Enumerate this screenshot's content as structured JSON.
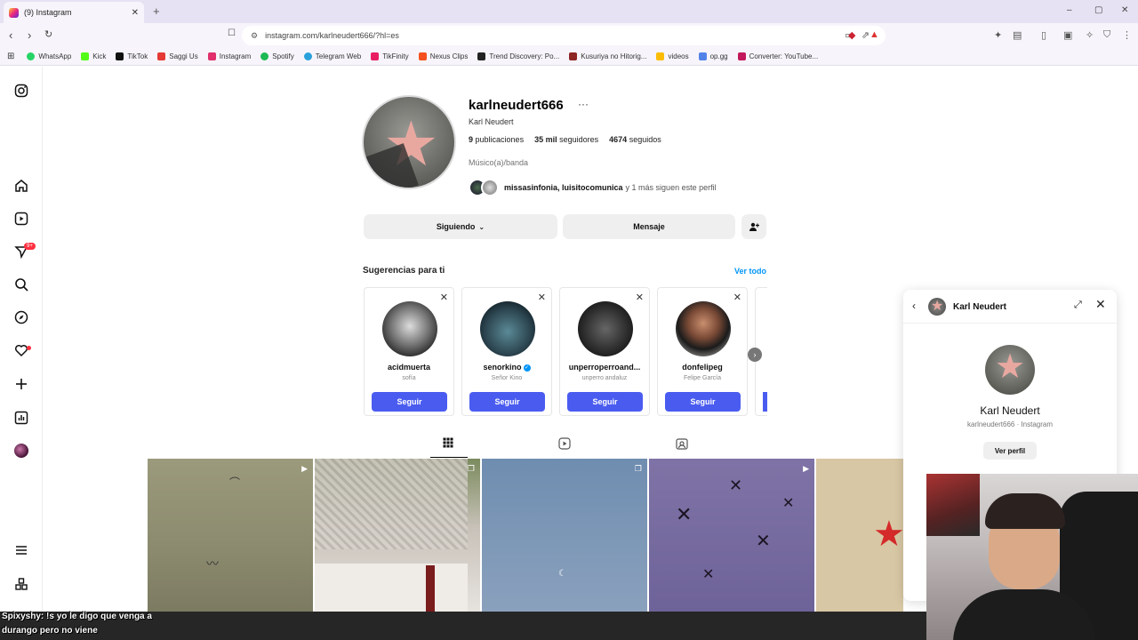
{
  "browser": {
    "tab_title": "(9) Instagram",
    "tab_close": "✕",
    "new_tab": "+",
    "url": "instagram.com/karlneudert666/?hl=es",
    "bookmarks": [
      {
        "label": "WhatsApp",
        "color": "#25d366"
      },
      {
        "label": "Kick",
        "color": "#53fc18"
      },
      {
        "label": "TikTok",
        "color": "#111111"
      },
      {
        "label": "Saggi Us",
        "color": "#e53935"
      },
      {
        "label": "Instagram",
        "color": "#e1306c"
      },
      {
        "label": "Spotify",
        "color": "#1db954"
      },
      {
        "label": "Telegram Web",
        "color": "#2aa1da"
      },
      {
        "label": "TikFinity",
        "color": "#e91e63"
      },
      {
        "label": "Nexus Clips",
        "color": "#f4511e"
      },
      {
        "label": "Trend Discovery: Po...",
        "color": "#222222"
      },
      {
        "label": "Kusuriya no Hitorig...",
        "color": "#8e2424"
      },
      {
        "label": "videos",
        "color": "#fbbc05"
      },
      {
        "label": "op.gg",
        "color": "#5383e8"
      },
      {
        "label": "Converter: YouTube...",
        "color": "#c2185b"
      }
    ]
  },
  "profile": {
    "username": "karlneudert666",
    "more": "···",
    "full_name": "Karl Neudert",
    "posts_count": "9",
    "posts_label": "publicaciones",
    "followers_count": "35 mil",
    "followers_label": "seguidores",
    "following_count": "4674",
    "following_label": "seguidos",
    "category": "Músico(a)/banda",
    "followed_by_names": "missasinfonia, luisitocomunica",
    "followed_by_tail": "y 1 más siguen este perfil",
    "following_button": "Siguiendo",
    "message_button": "Mensaje"
  },
  "suggestions": {
    "title": "Sugerencias para ti",
    "see_all": "Ver todo",
    "follow_label": "Seguir",
    "items": [
      {
        "username": "acidmuerta",
        "name": "sofía",
        "verified": false
      },
      {
        "username": "senorkino",
        "name": "Señor Kino",
        "verified": true
      },
      {
        "username": "unperroperroand...",
        "name": "unperro andaluz",
        "verified": false
      },
      {
        "username": "donfelipeg",
        "name": "Felipe García",
        "verified": false
      }
    ]
  },
  "notifications_badge": "9+",
  "dm_popup": {
    "name": "Karl Neudert",
    "full_name": "Karl Neudert",
    "subtitle": "karlneudert666 · Instagram",
    "view_profile": "Ver perfil"
  },
  "stream_chat": {
    "user": "Spixyshy",
    "message": "!s yo le digo que venga a durango pero no viene"
  },
  "colors": {
    "follow_button": "#4a5cf0",
    "link_blue": "#0095f6",
    "badge_red": "#ff3040"
  }
}
